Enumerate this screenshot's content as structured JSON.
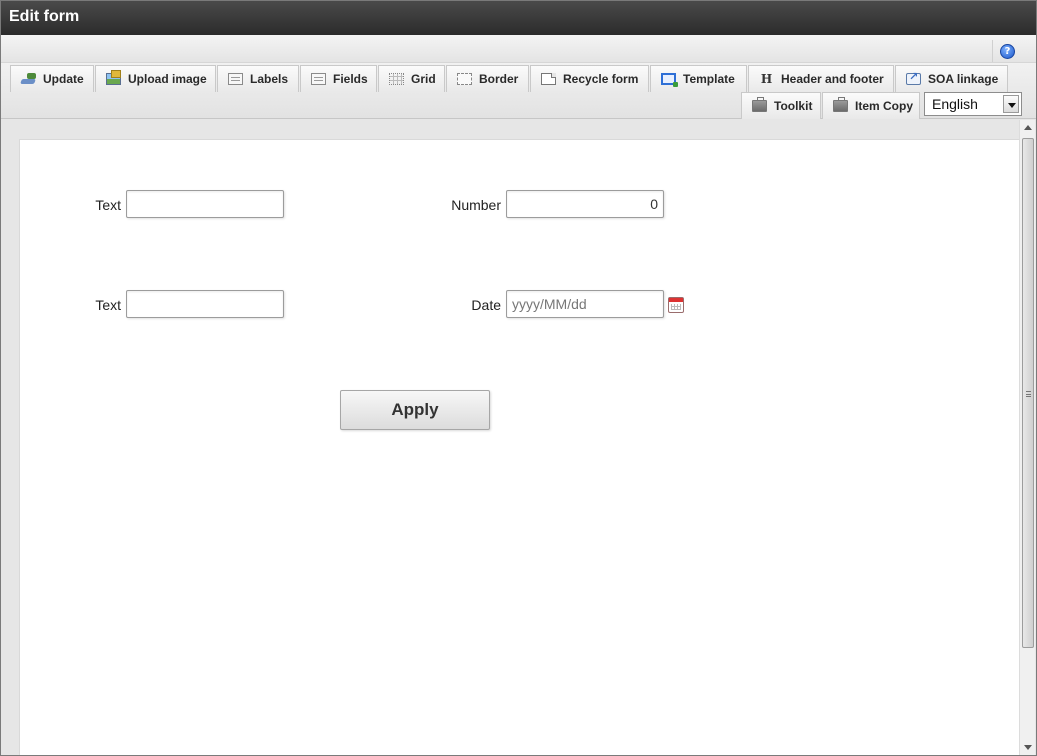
{
  "window": {
    "title": "Edit form"
  },
  "toolbar": {
    "row1": [
      {
        "label": "Update",
        "icon": "update-icon"
      },
      {
        "label": "Upload image",
        "icon": "image-icon"
      },
      {
        "label": "Labels",
        "icon": "labels-icon"
      },
      {
        "label": "Fields",
        "icon": "fields-icon"
      },
      {
        "label": "Grid",
        "icon": "grid-icon"
      },
      {
        "label": "Border",
        "icon": "border-icon"
      },
      {
        "label": "Recycle form",
        "icon": "document-icon"
      },
      {
        "label": "Template",
        "icon": "template-icon"
      },
      {
        "label": "Header and footer",
        "icon": "header-icon"
      },
      {
        "label": "SOA linkage",
        "icon": "link-icon"
      }
    ],
    "row2": [
      {
        "label": "Toolkit",
        "icon": "toolbox-icon"
      },
      {
        "label": "Item Copy",
        "icon": "toolbox-icon"
      }
    ],
    "language": {
      "selected": "English"
    }
  },
  "form": {
    "fields": [
      {
        "label": "Text",
        "value": "",
        "placeholder": ""
      },
      {
        "label": "Number",
        "value": "0"
      },
      {
        "label": "Text",
        "value": "",
        "placeholder": ""
      },
      {
        "label": "Date",
        "value": "",
        "placeholder": "yyyy/MM/dd"
      }
    ],
    "apply_label": "Apply"
  },
  "help": {
    "icon": "help-icon",
    "glyph": "?"
  }
}
